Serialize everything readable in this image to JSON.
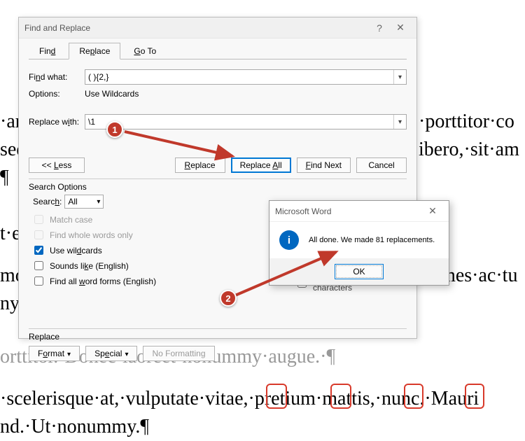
{
  "dialog": {
    "title": "Find and Replace",
    "tabs": {
      "find": "Find",
      "replace": "Replace",
      "goto": "Go To",
      "active": "replace"
    },
    "find_label": "Find what:",
    "find_value": "( ){2,}",
    "options_label": "Options:",
    "options_value": "Use Wildcards",
    "replace_label": "Replace with:",
    "replace_value": "\\1",
    "buttons": {
      "less": "<< Less",
      "replace": "Replace",
      "replace_all": "Replace All",
      "find_next": "Find Next",
      "cancel": "Cancel"
    },
    "search_options_title": "Search Options",
    "search_label": "Search:",
    "search_value": "All",
    "checks": {
      "match_case": "Match case",
      "whole_words": "Find whole words only",
      "wildcards": "Use wildcards",
      "sounds_like": "Sounds like (English)",
      "word_forms": "Find all word forms (English)",
      "ignore_ws": "Ignore white-space characters"
    },
    "replace_section": "Replace",
    "format_btn": "Format",
    "special_btn": "Special",
    "noformat_btn": "No Formatting"
  },
  "msgbox": {
    "title": "Microsoft Word",
    "text": "All done. We made 81 replacements.",
    "ok": "OK"
  },
  "callouts": {
    "one": "1",
    "two": "2"
  },
  "doc": {
    "l1a": "·ar",
    "l1b": "·porttitor·co",
    "l2a": "sed",
    "l2b": "ibero,·sit·am",
    "l3": "¶",
    "l4": "t·e",
    "l5": "mo",
    "l5b": "·fames·ac·tu",
    "l6": "ny",
    "l7": "orttitor.·Donec·laoreet·nonummy·augue.·¶",
    "l8": "·scelerisque·at,·vulputate·vitae,·pretium·mattis,·nunc.·Mauri",
    "l9": "nd.·Ut·nonummy.¶"
  }
}
